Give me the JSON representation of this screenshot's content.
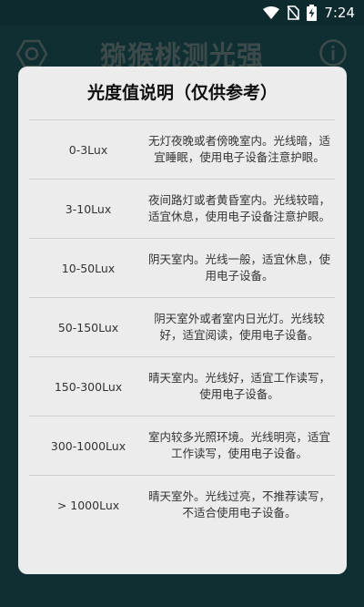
{
  "status_bar": {
    "time": "7:24",
    "icons": [
      "wifi-icon",
      "no-sim-icon",
      "battery-charging-icon"
    ]
  },
  "app": {
    "title": "猕猴桃测光强",
    "left_icon": "hexagon-settings-icon",
    "right_icon": "info-icon"
  },
  "dialog": {
    "title": "光度值说明（仅供参考）",
    "rows": [
      {
        "range": "0-3Lux",
        "desc_line1": "无灯夜晚或者傍晚室内。光线暗，适",
        "desc_line2": "宜睡眠，使用电子设备注意护眼。"
      },
      {
        "range": "3-10Lux",
        "desc_line1": "夜间路灯或者黄昏室内。光线较暗，",
        "desc_line2": "适宜休息，使用电子设备注意护眼。"
      },
      {
        "range": "10-50Lux",
        "desc_line1": "阴天室内。光线一般，适宜休息，使",
        "desc_line2": "用电子设备。"
      },
      {
        "range": "50-150Lux",
        "desc_line1": "阴天室外或者室内日光灯。光线较",
        "desc_line2": "好，适宜阅读，使用电子设备。"
      },
      {
        "range": "150-300Lux",
        "desc_line1": "晴天室内。光线好，适宜工作读写，",
        "desc_line2": "使用电子设备。"
      },
      {
        "range": "300-1000Lux",
        "desc_line1": "室内较多光照环境。光线明亮，适宜",
        "desc_line2": "工作读写，使用电子设备。"
      },
      {
        "range": "> 1000Lux",
        "desc_line1": "晴天室外。光线过亮，不推荐读写，",
        "desc_line2": "不适合使用电子设备。"
      }
    ]
  },
  "colors": {
    "background": "#0f2f33",
    "dialog": "#ececec",
    "divider": "#cfcfcf",
    "text": "#333333"
  }
}
